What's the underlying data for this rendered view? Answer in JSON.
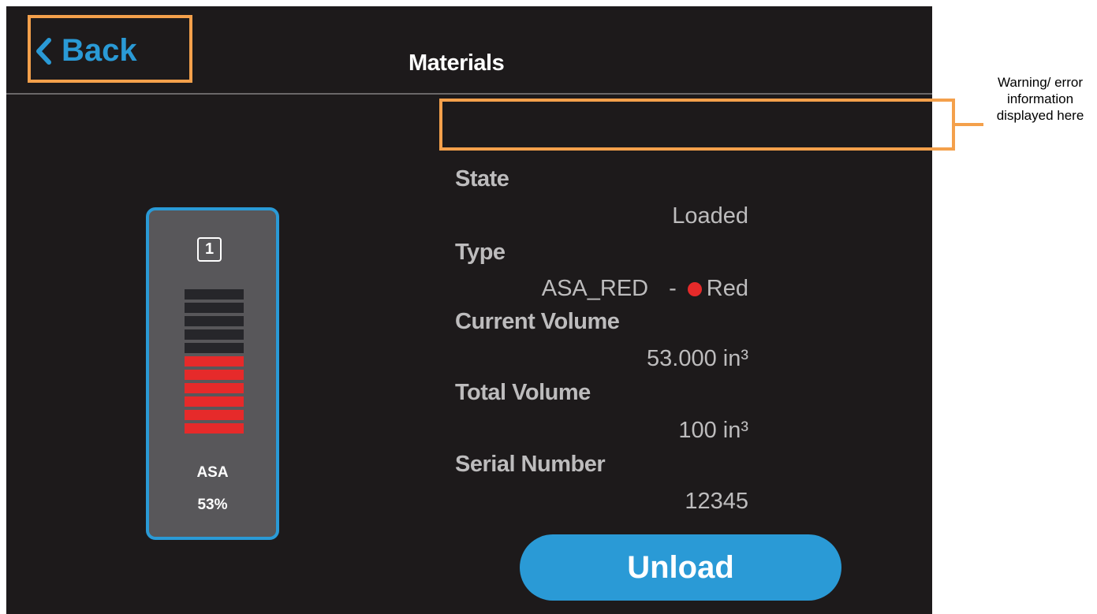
{
  "header": {
    "back_label": "Back",
    "title": "Materials"
  },
  "warning_area": {
    "message": "",
    "annotation": "Warning/ error information displayed here"
  },
  "cartridge": {
    "slot": "1",
    "material": "ASA",
    "percent": "53%",
    "fill_level": 0.53,
    "segments_total": 11,
    "segments_filled": 6,
    "fill_color": "#e62a2a",
    "empty_color": "#26262a",
    "border_color": "#2a9ad6"
  },
  "details": {
    "state_label": "State",
    "state_value": "Loaded",
    "type_label": "Type",
    "type_value": "ASA_RED",
    "type_separator": "-",
    "color_name": "Red",
    "color_hex": "#e62a2a",
    "current_volume_label": "Current Volume",
    "current_volume_value": "53.000 in³",
    "total_volume_label": "Total Volume",
    "total_volume_value": "100 in³",
    "serial_label": "Serial Number",
    "serial_value": "12345"
  },
  "actions": {
    "unload_label": "Unload"
  },
  "colors": {
    "accent": "#2a9ad6",
    "background": "#1d1a1b",
    "callout": "#f4a04b"
  },
  "icons": {
    "back": "chevron-left-icon",
    "color_swatch": "color-dot-icon"
  }
}
